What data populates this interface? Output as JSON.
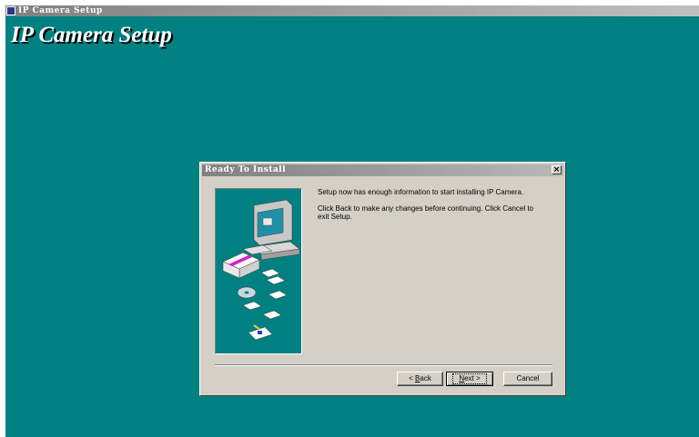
{
  "window": {
    "title": "IP Camera Setup",
    "icon": "setup-app-icon"
  },
  "main": {
    "heading": "IP Camera Setup"
  },
  "dialog": {
    "title": "Ready To Install",
    "close_label": "×",
    "message_1": "Setup now has enough information to start installing IP Camera.",
    "message_2": "Click Back to make any changes before continuing. Click Cancel to exit Setup.",
    "illustration": "installer-computer-illustration"
  },
  "buttons": {
    "back": {
      "prefix": "< ",
      "mnemonic": "B",
      "rest": "ack"
    },
    "next": {
      "mnemonic": "N",
      "rest": "ext",
      "suffix": " >"
    },
    "cancel": "Cancel"
  },
  "colors": {
    "desktop": "#008080",
    "dialog_face": "#d4d0c8",
    "titlebar_start": "#808080"
  }
}
